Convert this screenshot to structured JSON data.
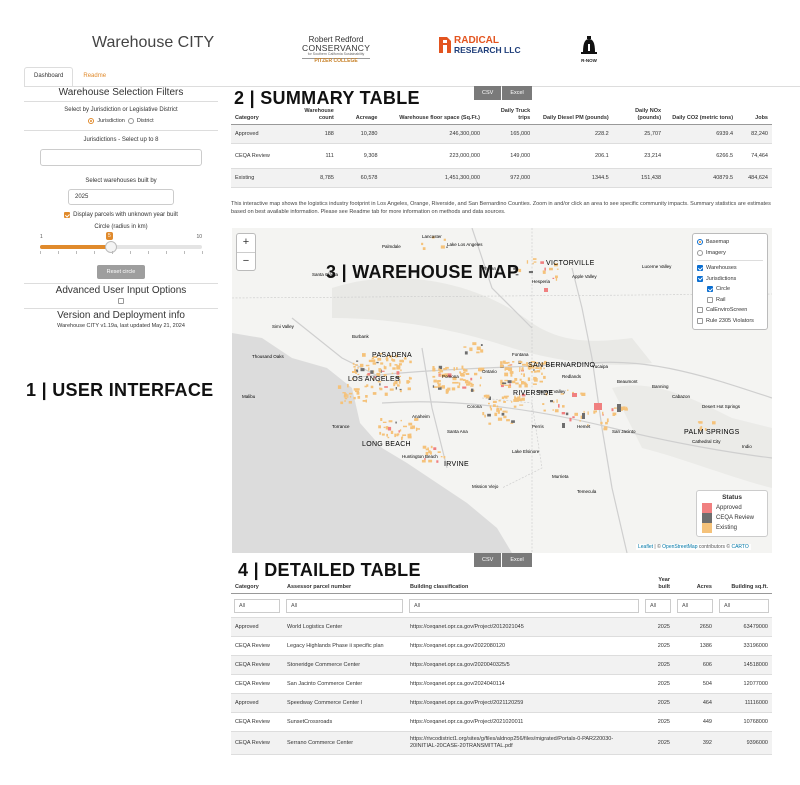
{
  "header": {
    "app_title": "Warehouse CITY",
    "logos": {
      "rr_line1": "Robert Redford",
      "rr_line2": "CONSERVANCY",
      "rr_line3": "for Southern California Sustainability",
      "rr_line4": "PITZER COLLEGE",
      "radical_line1": "RADICAL",
      "radical_line2": "RESEARCH LLC",
      "rnow_label": "R-NOW"
    }
  },
  "tabs": [
    "Dashboard",
    "Readme"
  ],
  "sidebar": {
    "filters_title": "Warehouse Selection Filters",
    "select_by_label": "Select by Jurisdiction or Legislative District",
    "radio_options": [
      "Jurisdiction",
      "District"
    ],
    "jurisdictions_label": "Jurisdictions - Select up to 8",
    "built_by_label": "Select warehouses built by",
    "built_by_value": "2025",
    "unknown_year_label": "Display parcels with unknown year built",
    "circle_label": "Circle (radius in km)",
    "slider": {
      "min": "1",
      "max": "10",
      "value": "5",
      "ticks": [
        "1",
        "2",
        "3",
        "4",
        "5",
        "6",
        "7",
        "8",
        "9",
        "10"
      ]
    },
    "reset_button": "Reset circle",
    "advanced_title": "Advanced User Input Options",
    "version_title": "Version and Deployment info",
    "version_text": "Warehouse CITY v1.19a, last updated May 21, 2024"
  },
  "annotations": {
    "a1": "1 | USER INTERFACE",
    "a2": "2 | SUMMARY TABLE",
    "a3": "3 | WAREHOUSE MAP",
    "a4": "4 | DETAILED TABLE"
  },
  "summary": {
    "buttons": [
      "CSV",
      "Excel"
    ],
    "headers": [
      "Category",
      "Warehouse count",
      "Acreage",
      "Warehouse floor space (Sq.Ft.)",
      "Daily Truck trips",
      "Daily Diesel PM (pounds)",
      "Daily NOx (pounds)",
      "Daily CO2 (metric tons)",
      "Jobs"
    ],
    "rows": [
      [
        "Approved",
        "188",
        "10,280",
        "246,300,000",
        "165,000",
        "228.2",
        "25,707",
        "6939.4",
        "82,240"
      ],
      [
        "CEQA Review",
        "111",
        "9,308",
        "223,000,000",
        "149,000",
        "206.1",
        "23,214",
        "6266.5",
        "74,464"
      ],
      [
        "Existing",
        "8,785",
        "60,578",
        "1,451,300,000",
        "972,000",
        "1344.5",
        "151,438",
        "40879.5",
        "484,624"
      ]
    ],
    "caption": "This interactive map shows the logistics industry footprint in Los Angeles, Orange, Riverside, and San Bernardino Counties. Zoom in and/or click an area to see specific community impacts. Summary statistics are estimates based on best available information. Please see Readme tab for more information on methods and data sources."
  },
  "map": {
    "zoom_in": "+",
    "zoom_out": "−",
    "layers": {
      "basemap": "Basemap",
      "imagery": "Imagery",
      "warehouses": "Warehouses",
      "jurisdictions": "Jurisdictions",
      "circle": "Circle",
      "rail": "Rail",
      "calenviro": "CalEnviroScreen",
      "rule2305": "Rule 2305 Violators"
    },
    "legend": {
      "title": "Status",
      "items": [
        {
          "label": "Approved",
          "color": "#f08080"
        },
        {
          "label": "CEQA Review",
          "color": "#6e6e6e"
        },
        {
          "label": "Existing",
          "color": "#f5c27a"
        }
      ]
    },
    "places": {
      "pasadena": "PASADENA",
      "los_angeles": "LOS ANGELES",
      "san_bernardino": "SAN BERNARDINO",
      "riverside": "RIVERSIDE",
      "long_beach": "LONG BEACH",
      "irvine": "IRVINE",
      "palm_springs": "PALM SPRINGS",
      "victorville": "VICTORVILLE"
    },
    "towns": [
      "Lake Los Angeles",
      "Phelan",
      "Hesperia",
      "Apple Valley",
      "Lucerne Valley",
      "Santa Clarita",
      "Simi Valley",
      "Burbank",
      "Pomona",
      "Ontario",
      "Fontana",
      "Yucaipa",
      "Redlands",
      "Beaumont",
      "Banning",
      "Cabazon",
      "Moreno Valley",
      "Perris",
      "Hemet",
      "San Jacinto",
      "Corona",
      "Anaheim",
      "Santa Ana",
      "Torrance",
      "Huntington Beach",
      "Lake Elsinore",
      "Murrieta",
      "Temecula",
      "Mission Viejo",
      "Cathedral City",
      "Indio",
      "Thousand Oaks",
      "Malibu",
      "Lancaster",
      "Palmdale",
      "Desert Hot Springs"
    ],
    "attribution": {
      "leaflet": "Leaflet",
      "sep": " | © ",
      "osm": "OpenStreetMap",
      "mid": " contributors © ",
      "carto": "CARTO"
    }
  },
  "detailed": {
    "buttons": [
      "CSV",
      "Excel"
    ],
    "headers": [
      "Category",
      "Assessor parcel number",
      "Building classification",
      "Year built",
      "Acres",
      "Building sq.ft."
    ],
    "filter_placeholder": "All",
    "rows": [
      [
        "Approved",
        "World Logistics Center",
        "https://ceqanet.opr.ca.gov/Project/2012021045",
        "2025",
        "2650",
        "63479000"
      ],
      [
        "CEQA Review",
        "Legacy Highlands Phase ii specific plan",
        "https://ceqanet.opr.ca.gov/2022080120",
        "2025",
        "1386",
        "33196000"
      ],
      [
        "CEQA Review",
        "Stoneridge Commerce Center",
        "https://ceqanet.opr.ca.gov/2020040325/5",
        "2025",
        "606",
        "14518000"
      ],
      [
        "CEQA Review",
        "San Jacinto Commerce Center",
        "https://ceqanet.opr.ca.gov/2024040114",
        "2025",
        "504",
        "12077000"
      ],
      [
        "Approved",
        "Speedway Commerce Center I",
        "https://ceqanet.opr.ca.gov/Project/2021120259",
        "2025",
        "464",
        "11116000"
      ],
      [
        "CEQA Review",
        "SunsetCrossroads",
        "https://ceqanet.opr.ca.gov/Project/2021020011",
        "2025",
        "449",
        "10768000"
      ],
      [
        "CEQA Review",
        "Serrano Commerce Center",
        "https://rivcodistrict1.org/sites/g/files/aldnop256/files/migrated/Portals-0-PAR220030-20INITIAL-20CASE-20TRANSMITTAL.pdf",
        "2025",
        "392",
        "9396000"
      ]
    ]
  }
}
